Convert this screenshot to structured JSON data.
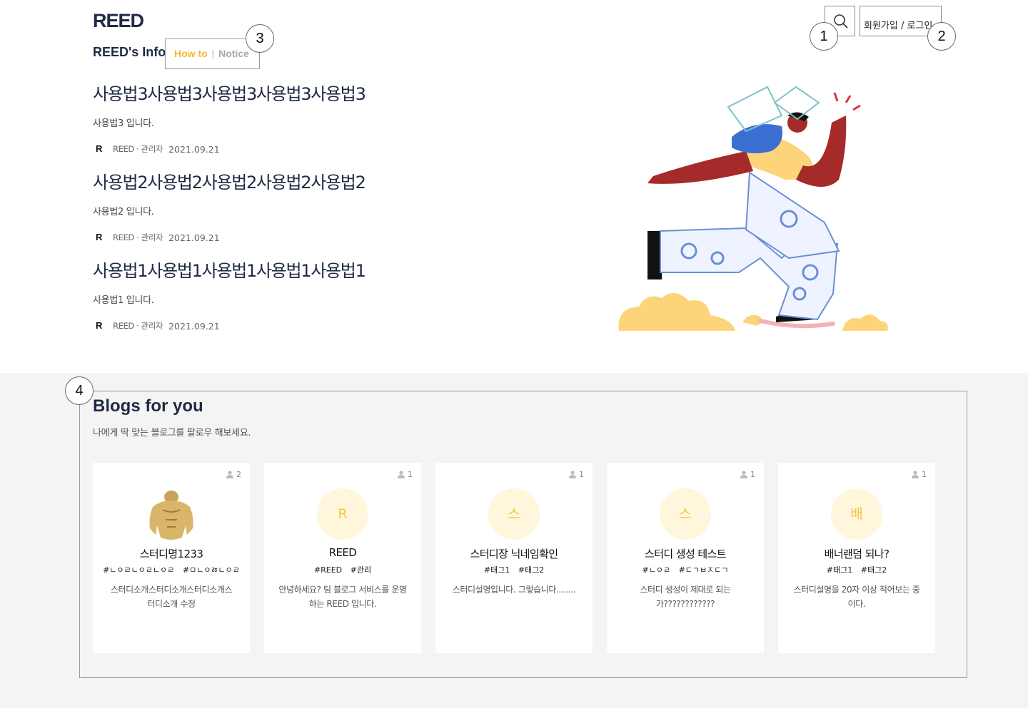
{
  "header": {
    "logo_text": "REED",
    "auth_label": "회원가입 / 로그인"
  },
  "markers": [
    "1",
    "2",
    "3",
    "4"
  ],
  "info": {
    "title": "REED's Info",
    "tab_howto": "How to",
    "tab_separator": "|",
    "tab_notice": "Notice"
  },
  "posts": [
    {
      "title": "사용법3사용법3사용법3사용법3사용법3",
      "description": "사용법3 입니다.",
      "author": "REED · 관리자",
      "date": "2021.09.21"
    },
    {
      "title": "사용법2사용법2사용법2사용법2사용법2",
      "description": "사용법2 입니다.",
      "author": "REED · 관리자",
      "date": "2021.09.21"
    },
    {
      "title": "사용법1사용법1사용법1사용법1사용법1",
      "description": "사용법1 입니다.",
      "author": "REED · 관리자",
      "date": "2021.09.21"
    }
  ],
  "blogs": {
    "title": "Blogs for you",
    "subtitle": "나에게 딱 맞는 블로그를 팔로우 해보세요.",
    "cards": [
      {
        "count": "2",
        "avatar_text": "",
        "name": "스터디명1233",
        "tags": [
          "#ㄴㅇㄹㄴㅇㄹㄴㅇㄹ",
          "#ㅁㄴㅇㅀㄴㅇㄹ"
        ],
        "description": "스터디소개스터디소개스터디소개스터디소개 수정"
      },
      {
        "count": "1",
        "avatar_text": "R",
        "name": "REED",
        "tags": [
          "#REED",
          "#관리"
        ],
        "description": "안녕하세요? 팀 블로그 서비스를 운영하는 REED 입니다."
      },
      {
        "count": "1",
        "avatar_text": "스",
        "name": "스터디장 닉네임확인",
        "tags": [
          "#태그1",
          "#태그2"
        ],
        "description": "스터디설명입니다. 그렇습니다........"
      },
      {
        "count": "1",
        "avatar_text": "스",
        "name": "스터디 생성 테스트",
        "tags": [
          "#ㄴㅇㄹ",
          "#ㄷㄱㅂㅈㄷㄱ"
        ],
        "description": "스터디 생성이 제대로 되는가????????????"
      },
      {
        "count": "1",
        "avatar_text": "배",
        "name": "배너랜덤 되나?",
        "tags": [
          "#태그1",
          "#태그2"
        ],
        "description": "스터디설명을 20자 이상 적어보는 중이다."
      }
    ]
  }
}
